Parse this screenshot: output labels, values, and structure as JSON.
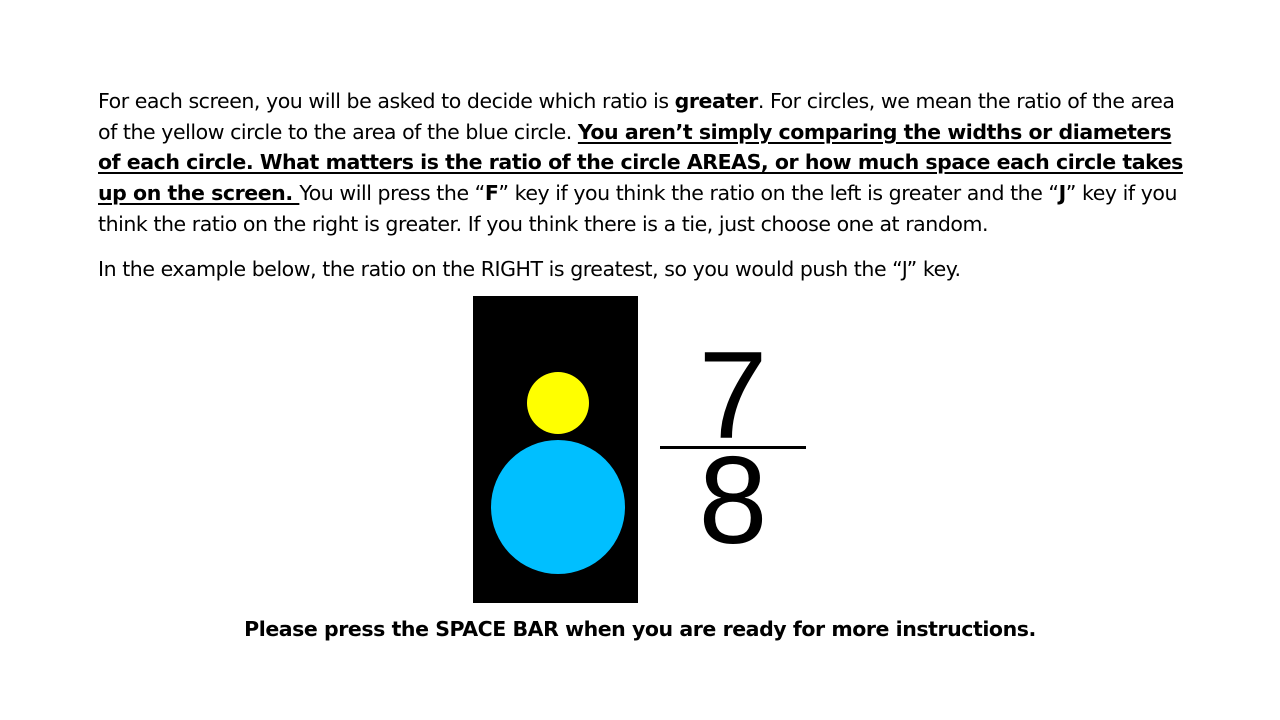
{
  "instructions": {
    "p1_a": "For each screen, you will be asked to decide which ratio is ",
    "p1_b": "greater",
    "p1_c": ". For circles, we mean the ratio of the area of the yellow circle to the area of the blue circle. ",
    "p1_d": "You aren’t simply comparing the widths or diameters of each circle. What matters is the ratio of the circle AREAS, or how much space each circle takes up on the screen. ",
    "p1_e": "You will press the “",
    "p1_f": "F",
    "p1_g": "” key if you think the ratio on the left is greater and the “",
    "p1_h": "J",
    "p1_i": "” key if you think the ratio on the right is greater. If you think there is a tie, just choose one at random.",
    "p2": "In the example below, the ratio on the RIGHT is greatest, so you would push the “J” key."
  },
  "example": {
    "panel_color": "#000000",
    "yellow_circle_color": "#FFFF00",
    "blue_circle_color": "#00BFFF",
    "fraction": {
      "numerator": "7",
      "denominator": "8"
    }
  },
  "footer": {
    "prompt": "Please press the SPACE BAR when you are ready for more instructions."
  }
}
